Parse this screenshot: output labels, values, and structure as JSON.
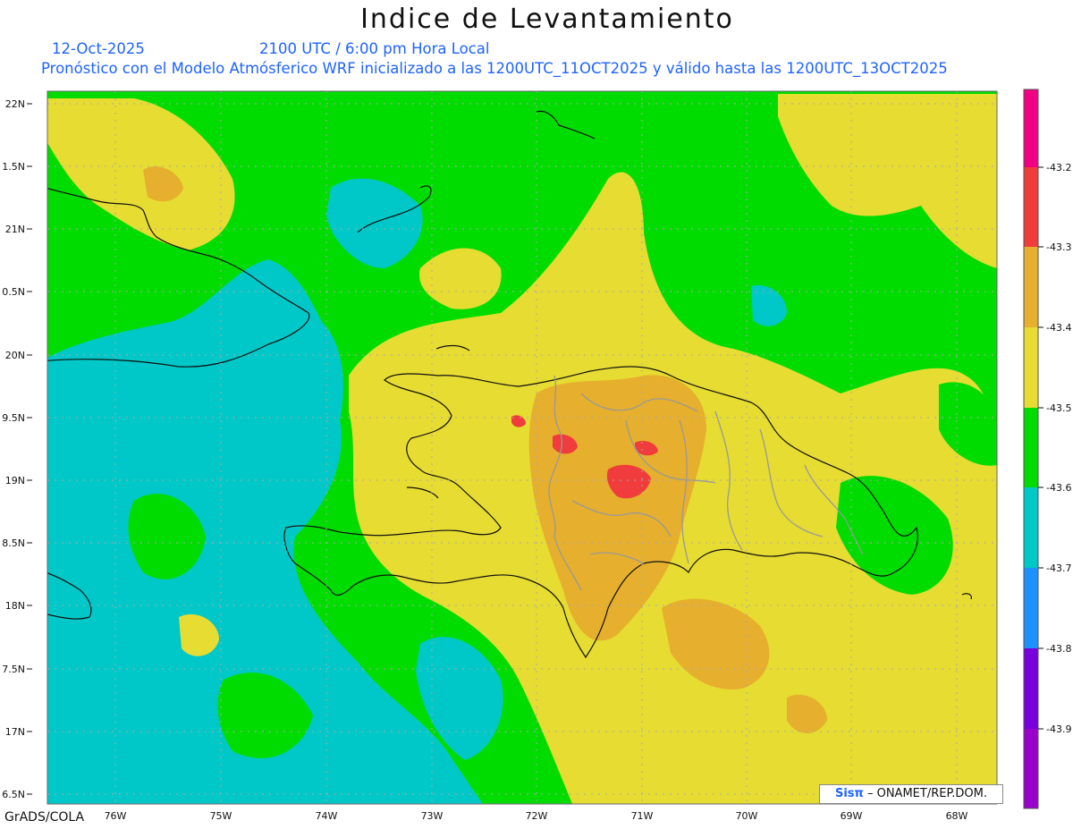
{
  "header": {
    "title": "Indice de Levantamiento",
    "date": "12-Oct-2025",
    "valid_time": "2100 UTC / 6:00 pm Hora Local",
    "description": "Pronóstico con el Modelo Atmósferico WRF inicializado a las 1200UTC_11OCT2025 y válido hasta las  1200UTC_13OCT2025"
  },
  "axes": {
    "lat_labels": [
      "22N",
      "1.5N",
      "21N",
      "0.5N",
      "20N",
      "9.5N",
      "19N",
      "8.5N",
      "18N",
      "7.5N",
      "17N",
      "6.5N"
    ],
    "lon_labels": [
      "76W",
      "75W",
      "74W",
      "73W",
      "72W",
      "71W",
      "70W",
      "69W",
      "68W"
    ]
  },
  "colorbar": {
    "labels": [
      "-43.2",
      "-43.3",
      "-43.4",
      "-43.5",
      "-43.6",
      "-43.7",
      "-43.8",
      "-43.9"
    ],
    "colors": [
      "#9900cc",
      "#7700dd",
      "#1e90ff",
      "#00c8c8",
      "#00dc00",
      "#e6dc32",
      "#e6af2d",
      "#f03c3c",
      "#f00082"
    ]
  },
  "field_colors": {
    "cyan": "#00c8c8",
    "green": "#00dc00",
    "yellow": "#e6dc32",
    "orange": "#e6af2d",
    "red": "#f03c3c",
    "blue": "#1e90ff"
  },
  "footer": {
    "software": "GrADS/COLA",
    "credit_logo": "Sisπ",
    "credit": "– ONAMET/REP.DOM."
  }
}
